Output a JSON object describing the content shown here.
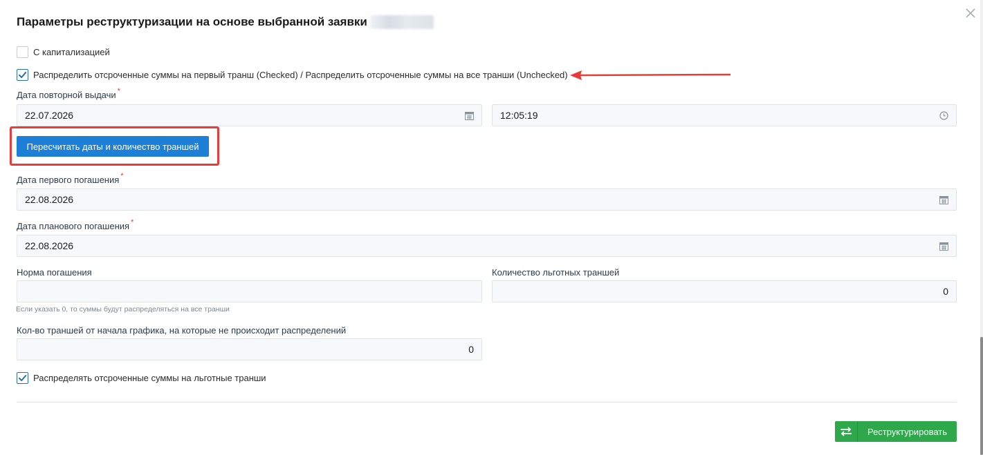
{
  "dialog": {
    "title": "Параметры реструктуризации на основе выбранной заявки"
  },
  "checkboxes": {
    "capitalization": {
      "label": "С капитализацией",
      "checked": false
    },
    "distribute_first": {
      "label": "Распределить отсроченные суммы на первый транш (Checked) / Распределить отсроченные суммы на все транши (Unchecked)",
      "checked": true
    },
    "distribute_grace": {
      "label": "Распределять отсроченные суммы на льготные транши",
      "checked": true
    }
  },
  "fields": {
    "reissue_date": {
      "label": "Дата повторной выдачи",
      "required": "*",
      "value": "22.07.2026",
      "time": "12:05:19"
    },
    "first_payment_date": {
      "label": "Дата первого погашения",
      "required": "*",
      "value": "22.08.2026"
    },
    "planned_payment_date": {
      "label": "Дата планового погашения",
      "required": "*",
      "value": "22.08.2026"
    },
    "repayment_rate": {
      "label": "Норма погашения",
      "value": "",
      "hint": "Если указать 0, то суммы будут распределяться на все транши"
    },
    "grace_tranches": {
      "label": "Количество льготных траншей",
      "value": "0"
    },
    "skip_tranches": {
      "label": "Кол-во траншей от начала графика, на которые не происходит распределений",
      "value": "0"
    }
  },
  "buttons": {
    "recalc": "Пересчитать даты и количество траншей",
    "submit": "Реструктурировать"
  },
  "icons": {
    "close": "close-icon",
    "calendar": "calendar-icon",
    "clock": "clock-icon",
    "check": "check-icon",
    "swap": "swap-arrows-icon"
  },
  "colors": {
    "primary": "#1d7fd6",
    "success": "#2ea84a",
    "annotation": "#ea3b3b",
    "required": "#e53935"
  }
}
